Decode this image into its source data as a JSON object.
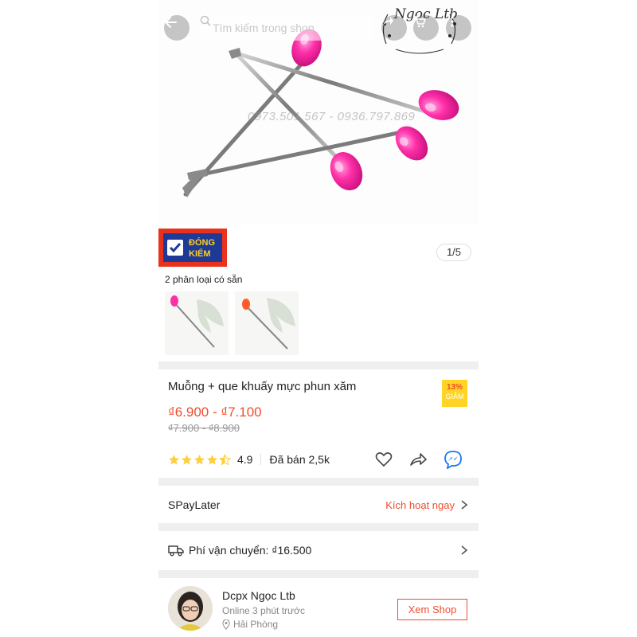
{
  "header": {
    "search_placeholder": "Tìm kiếm trong shop",
    "watermark_brand": "Ngọc Ltb",
    "watermark_phone": "0973.501.567 - 0936.797.869"
  },
  "gallery": {
    "badge_line1": "ĐÓNG",
    "badge_line2": "KIỂM",
    "page_indicator": "1/5",
    "variants_label": "2 phân loại có sẵn",
    "variant_count": 2
  },
  "product": {
    "title": "Muỗng + que khuấy mực phun xăm",
    "discount_pct": "13%",
    "discount_label": "GIẢM",
    "price": "₫6.900 - ₫7.100",
    "old_price": "₫7.900 - ₫8.900",
    "rating": "4.9",
    "rating_stars": 4.5,
    "sold": "Đã bán 2,5k"
  },
  "spaylater": {
    "label": "SPayLater",
    "action": "Kích hoạt ngay"
  },
  "shipping": {
    "label": "Phí vận chuyển: ₫16.500"
  },
  "shop": {
    "name": "Dcpx Ngọc Ltb",
    "status": "Online 3 phút trước",
    "location": "Hải Phòng",
    "view_button": "Xem Shop"
  },
  "colors": {
    "accent": "#ee4d2d",
    "star": "#ffce3d",
    "discount_bg": "#ffd424",
    "separator": "#efefef"
  }
}
